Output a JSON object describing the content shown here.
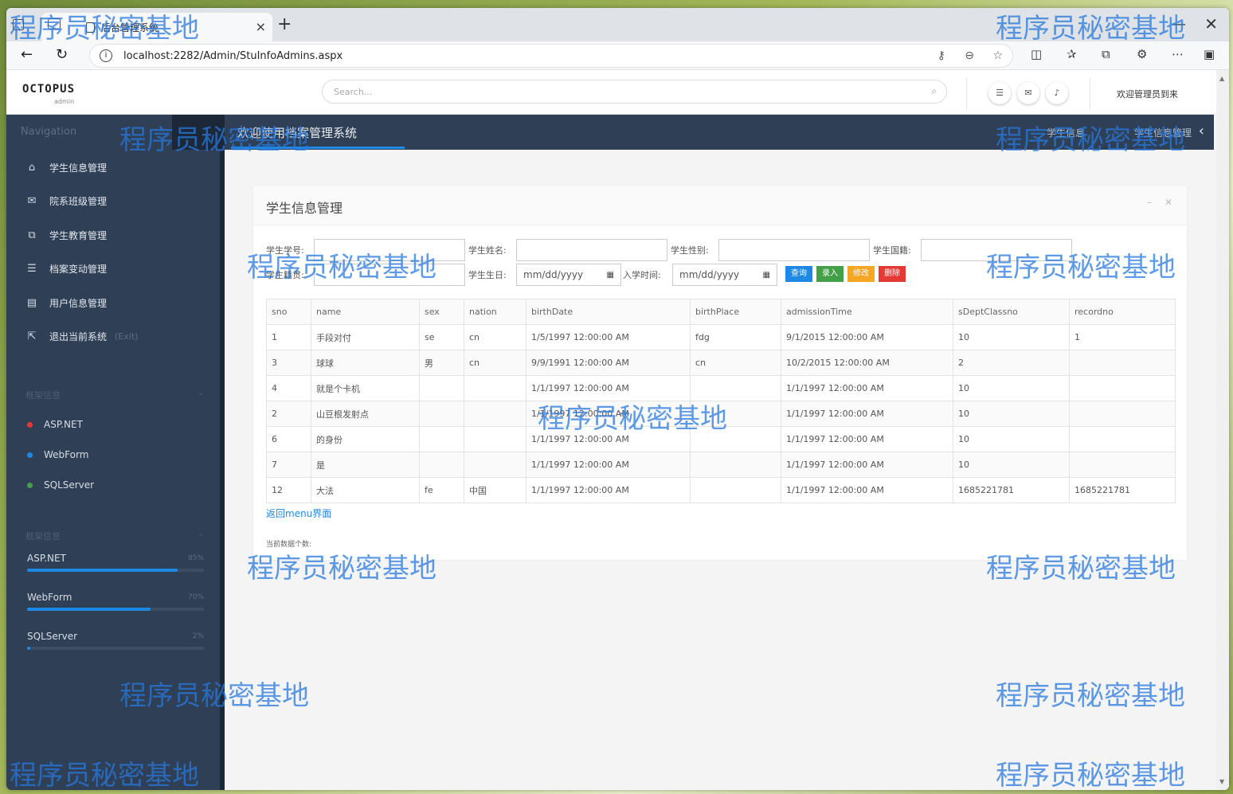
{
  "browser": {
    "tab_title": "后台管理系统",
    "new_tab": "+",
    "tab_close": "×",
    "url": "localhost:2282/Admin/StuInfoAdmins.aspx"
  },
  "topbar": {
    "logo": "OCTOPUS",
    "logo_sub": "admin",
    "search_placeholder": "Search...",
    "admin_label": "欢迎管理员到来"
  },
  "sidebar": {
    "nav_title": "Navigation",
    "items": [
      {
        "icon": "home-icon",
        "label": "学生信息管理"
      },
      {
        "icon": "envelope-icon",
        "label": "院系班级管理"
      },
      {
        "icon": "copy-icon",
        "label": "学生教育管理"
      },
      {
        "icon": "list-icon",
        "label": "档案变动管理"
      },
      {
        "icon": "user-list-icon",
        "label": "用户信息管理"
      },
      {
        "icon": "external-link-icon",
        "label": "退出当前系统",
        "tag": "(Exit)"
      }
    ],
    "section1_title": "框架信息",
    "dots": [
      {
        "label": "ASP.NET",
        "color": "#e53935"
      },
      {
        "label": "WebForm",
        "color": "#1e88e5"
      },
      {
        "label": "SQLServer",
        "color": "#43a047"
      }
    ],
    "section2_title": "框架信息",
    "bars": [
      {
        "label": "ASP.NET",
        "pct_text": "85%",
        "value": 85
      },
      {
        "label": "WebForm",
        "pct_text": "70%",
        "value": 70
      },
      {
        "label": "SQLServer",
        "pct_text": "2%",
        "value": 2
      }
    ]
  },
  "content": {
    "welcome": "欢迎使用档案管理系统",
    "breadcrumb": "学生信息",
    "breadcrumb2": "学生信息管理"
  },
  "panel": {
    "title": "学生信息管理",
    "filters": {
      "sno_label": "学生学号:",
      "name_label": "学生姓名:",
      "sex_label": "学生性别:",
      "nation_label": "学生国籍:",
      "birthplace_label": "学生籍贯:",
      "birthdate_label": "学生生日:",
      "birthdate_placeholder": "mm/dd/yyyy",
      "admission_label": "入学时间:",
      "admission_placeholder": "mm/dd/yyyy"
    },
    "buttons": {
      "query": {
        "label": "查询",
        "color": "#1e88e5"
      },
      "add": {
        "label": "录入",
        "color": "#43a047"
      },
      "edit": {
        "label": "修改",
        "color": "#f5a623"
      },
      "delete": {
        "label": "删除",
        "color": "#e53935"
      }
    },
    "table": {
      "headers": [
        "sno",
        "name",
        "sex",
        "nation",
        "birthDate",
        "birthPlace",
        "admissionTime",
        "sDeptClassno",
        "recordno"
      ],
      "rows": [
        [
          "1",
          "手段对付",
          "se",
          "cn",
          "1/5/1997 12:00:00 AM",
          "fdg",
          "9/1/2015 12:00:00 AM",
          "10",
          "1"
        ],
        [
          "3",
          "球球",
          "男",
          "cn",
          "9/9/1991 12:00:00 AM",
          "cn",
          "10/2/2015 12:00:00 AM",
          "2",
          ""
        ],
        [
          "4",
          "就是个卡机",
          "",
          "",
          "1/1/1997 12:00:00 AM",
          "",
          "1/1/1997 12:00:00 AM",
          "10",
          ""
        ],
        [
          "2",
          "山豆根发射点",
          "",
          "",
          "1/1/1997 12:00:00 AM",
          "",
          "1/1/1997 12:00:00 AM",
          "10",
          ""
        ],
        [
          "6",
          "的身份",
          "",
          "",
          "1/1/1997 12:00:00 AM",
          "",
          "1/1/1997 12:00:00 AM",
          "10",
          ""
        ],
        [
          "7",
          "是",
          "",
          "",
          "1/1/1997 12:00:00 AM",
          "",
          "1/1/1997 12:00:00 AM",
          "10",
          ""
        ],
        [
          "12",
          "大法",
          "fe",
          "中国",
          "1/1/1997 12:00:00 AM",
          "",
          "1/1/1997 12:00:00 AM",
          "1685221781",
          "1685221781"
        ]
      ]
    },
    "back_link": "返回menu界面",
    "count_text": "当前数据个数:"
  },
  "watermark": "程序员秘密基地"
}
